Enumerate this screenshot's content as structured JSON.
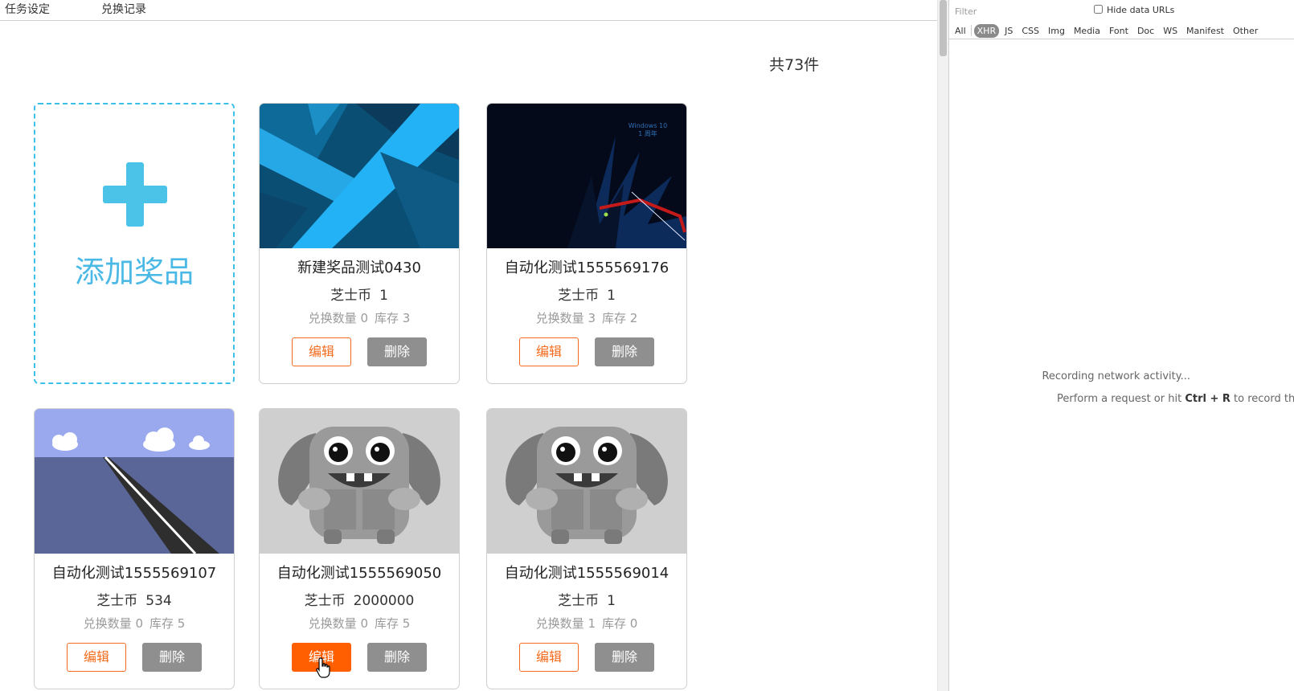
{
  "nav": {
    "tabs": [
      "任务设定",
      "兑换记录"
    ]
  },
  "total_count": "共73件",
  "add_card": {
    "label": "添加奖品"
  },
  "currency": "芝士币",
  "labels": {
    "exchanged": "兑换数量",
    "stock": "库存",
    "edit": "编辑",
    "delete": "删除"
  },
  "prizes": [
    {
      "name": "新建奖品测试0430",
      "price": "1",
      "exchanged": "0",
      "stock": "3",
      "image": "blue-geometric"
    },
    {
      "name": "自动化测试1555569176",
      "price": "1",
      "exchanged": "3",
      "stock": "2",
      "image": "windows-cat"
    },
    {
      "name": "自动化测试1555569107",
      "price": "534",
      "exchanged": "0",
      "stock": "5",
      "image": "road-landscape"
    },
    {
      "name": "自动化测试1555569050",
      "price": "2000000",
      "exchanged": "0",
      "stock": "5",
      "image": "gray-monster"
    },
    {
      "name": "自动化测试1555569014",
      "price": "1",
      "exchanged": "1",
      "stock": "0",
      "image": "gray-monster"
    }
  ],
  "thumbnail_text": {
    "windows_line1": "Windows 10",
    "windows_line2": "1 周年"
  },
  "devtools": {
    "filter_placeholder": "Filter",
    "hide_data_urls": "Hide data URLs",
    "types": [
      "All",
      "XHR",
      "JS",
      "CSS",
      "Img",
      "Media",
      "Font",
      "Doc",
      "WS",
      "Manifest",
      "Other"
    ],
    "selected_type": "XHR",
    "empty_line1": "Recording network activity...",
    "empty_line2_prefix": "Perform a request or hit ",
    "empty_line2_keys": "Ctrl + R",
    "empty_line2_suffix": " to record the re"
  },
  "colors": {
    "accent_orange": "#f36b1c",
    "accent_blue": "#4bc3e9",
    "delete_gray": "#8f8f8f"
  }
}
